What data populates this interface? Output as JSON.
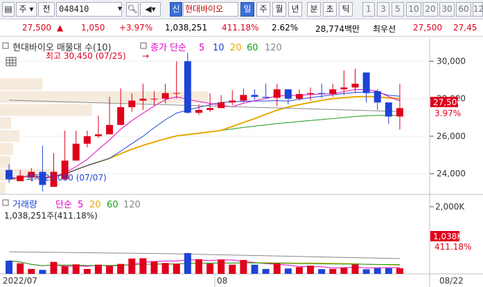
{
  "toolbar": {
    "stock_type": "주",
    "prev_label": "전",
    "code": "048410",
    "stock_name": "현대바이오",
    "periods": [
      "일",
      "주",
      "월",
      "년",
      "분",
      "초",
      "틱"
    ],
    "selected_period": "일",
    "intervals": [
      "1",
      "3",
      "5",
      "10",
      "20",
      "30",
      "60",
      "12"
    ],
    "badge": "신"
  },
  "quote": {
    "price": "27,500",
    "change_arrow": "▲",
    "change": "1,050",
    "change_pct": "+3.97%",
    "volume": "1,038,251",
    "volume_ratio": "411.18%",
    "turnover": "2.62%",
    "amount": "28,774백만",
    "best_bid_label": "최우선",
    "best_bid": "27,500",
    "best_ask": "27,45"
  },
  "price_panel": {
    "title": "현대바이오 매물대 수(10)",
    "legend_label": "종가 단순",
    "ma_periods": [
      "5",
      "10",
      "20",
      "60",
      "120"
    ],
    "high_annotation": "최고 30,450 (07/25)",
    "low_annotation": "최저 23,050 (07/07)",
    "y_ticks": [
      "30,000",
      "28,000",
      "26,000",
      "24,000"
    ],
    "current_price_tag": "27,500",
    "current_pct_tag": "3.97%"
  },
  "volume_panel": {
    "title": "거래량",
    "legend_label": "단순",
    "ma_periods": [
      "5",
      "20",
      "60",
      "120"
    ],
    "volume_text": "1,038,251주(411.18%)",
    "y_tick": "2,000K",
    "current_volume_tag": "1,038K",
    "current_pct_tag": "411.18%"
  },
  "x_axis": {
    "labels": [
      "2022/07",
      "08",
      "08/22"
    ]
  },
  "colors": {
    "up": "#e0001b",
    "down": "#1e44d6",
    "ma5": "#e000c8",
    "ma10": "#1e44d6",
    "ma20": "#e8a800",
    "ma60": "#1a9a1a",
    "ma120": "#888888"
  },
  "chart_data": {
    "type": "candlestick",
    "dates": [
      "07/01",
      "07/04",
      "07/05",
      "07/06",
      "07/07",
      "07/08",
      "07/11",
      "07/12",
      "07/13",
      "07/14",
      "07/15",
      "07/18",
      "07/19",
      "07/20",
      "07/21",
      "07/22",
      "07/25",
      "07/26",
      "07/27",
      "07/28",
      "07/29",
      "08/01",
      "08/02",
      "08/03",
      "08/04",
      "08/05",
      "08/08",
      "08/09",
      "08/10",
      "08/11",
      "08/12",
      "08/16",
      "08/17",
      "08/18",
      "08/19",
      "08/22"
    ],
    "open": [
      24200,
      23600,
      23800,
      24100,
      23300,
      23700,
      24700,
      25600,
      26000,
      26100,
      26600,
      27550,
      27900,
      28000,
      28000,
      28300,
      30000,
      27250,
      27400,
      27500,
      27800,
      27900,
      28200,
      28100,
      28050,
      28500,
      28000,
      28250,
      28300,
      28250,
      28500,
      28600,
      29400,
      28400,
      27800,
      27050
    ],
    "high": [
      24500,
      24200,
      24300,
      25500,
      25100,
      26300,
      26300,
      26300,
      27100,
      28100,
      28550,
      28300,
      28800,
      28400,
      28800,
      30000,
      30450,
      27700,
      28300,
      28200,
      28450,
      28550,
      28500,
      28800,
      28800,
      28500,
      28500,
      28600,
      28800,
      28800,
      29500,
      29600,
      28800,
      28500,
      27800,
      28800
    ],
    "low": [
      23500,
      23600,
      23600,
      23050,
      23300,
      23700,
      24700,
      25400,
      25900,
      26100,
      26600,
      27300,
      27400,
      27650,
      27750,
      28000,
      27200,
      27150,
      27300,
      27500,
      27650,
      27800,
      27950,
      28050,
      27600,
      27700,
      27900,
      27900,
      28050,
      28100,
      28200,
      28300,
      27800,
      27400,
      26650,
      26350
    ],
    "close": [
      23700,
      23900,
      24100,
      23400,
      24100,
      24700,
      25600,
      26000,
      26100,
      26600,
      27550,
      27900,
      28000,
      28000,
      28300,
      28300,
      27250,
      27400,
      27500,
      27800,
      27900,
      28200,
      28100,
      28050,
      28500,
      28000,
      28250,
      28300,
      28250,
      28500,
      28600,
      28800,
      28300,
      27800,
      27050,
      27500
    ],
    "volume": [
      430,
      345,
      160,
      130,
      390,
      250,
      310,
      160,
      300,
      265,
      325,
      500,
      510,
      410,
      355,
      330,
      680,
      480,
      335,
      470,
      300,
      455,
      300,
      160,
      340,
      175,
      220,
      270,
      155,
      160,
      205,
      305,
      150,
      185,
      185,
      185
    ],
    "volume_unit": "K",
    "ylim_price": [
      22900,
      31200
    ],
    "ylim_volume": [
      0,
      2600
    ]
  }
}
